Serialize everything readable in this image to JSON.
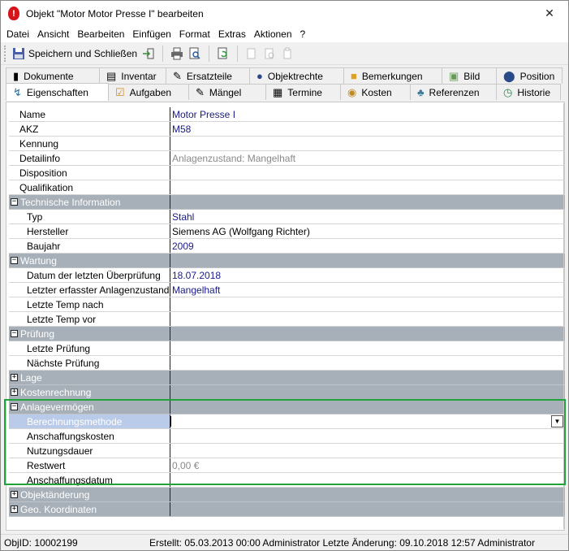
{
  "window": {
    "title": "Objekt \"Motor Motor Presse I\" bearbeiten",
    "app_icon": "!",
    "close_label": "✕"
  },
  "menu": [
    "Datei",
    "Ansicht",
    "Bearbeiten",
    "Einfügen",
    "Format",
    "Extras",
    "Aktionen",
    "?"
  ],
  "toolbar": {
    "save_close_label": "Speichern und Schließen"
  },
  "tabs": {
    "row1": [
      {
        "label": "Dokumente",
        "icon": "document-icon"
      },
      {
        "label": "Inventar",
        "icon": "inventory-icon"
      },
      {
        "label": "Ersatzteile",
        "icon": "spare-parts-icon"
      },
      {
        "label": "Objektrechte",
        "icon": "users-icon"
      },
      {
        "label": "Bemerkungen",
        "icon": "notes-icon"
      },
      {
        "label": "Bild",
        "icon": "image-icon"
      },
      {
        "label": "Position",
        "icon": "location-icon"
      }
    ],
    "row2": [
      {
        "label": "Eigenschaften",
        "icon": "properties-icon"
      },
      {
        "label": "Aufgaben",
        "icon": "tasks-icon"
      },
      {
        "label": "Mängel",
        "icon": "defects-icon"
      },
      {
        "label": "Termine",
        "icon": "calendar-icon"
      },
      {
        "label": "Kosten",
        "icon": "costs-icon"
      },
      {
        "label": "Referenzen",
        "icon": "references-icon"
      },
      {
        "label": "Historie",
        "icon": "history-icon"
      }
    ]
  },
  "properties": [
    {
      "type": "row",
      "label": "Name",
      "value": "Motor Presse I"
    },
    {
      "type": "row",
      "label": "AKZ",
      "value": "M58"
    },
    {
      "type": "row",
      "label": "Kennung",
      "value": ""
    },
    {
      "type": "row",
      "label": "Detailinfo",
      "value": "Anlagenzustand: Mangelhaft",
      "gray": true
    },
    {
      "type": "row",
      "label": "Disposition",
      "value": ""
    },
    {
      "type": "row",
      "label": "Qualifikation",
      "value": ""
    },
    {
      "type": "hdr",
      "label": "Technische Information",
      "expanded": true
    },
    {
      "type": "sub",
      "label": "Typ",
      "value": "Stahl"
    },
    {
      "type": "sub",
      "label": "Hersteller",
      "value": "Siemens AG    (Wolfgang Richter)",
      "dark": true
    },
    {
      "type": "sub",
      "label": "Baujahr",
      "value": "2009"
    },
    {
      "type": "hdr",
      "label": "Wartung",
      "expanded": true
    },
    {
      "type": "sub",
      "label": "Datum der letzten Überprüfung",
      "value": "18.07.2018"
    },
    {
      "type": "sub",
      "label": "Letzter erfasster Anlagenzustand",
      "value": "Mangelhaft"
    },
    {
      "type": "sub",
      "label": "Letzte Temp nach",
      "value": ""
    },
    {
      "type": "sub",
      "label": "Letzte Temp vor",
      "value": ""
    },
    {
      "type": "hdr",
      "label": "Prüfung",
      "expanded": true
    },
    {
      "type": "sub",
      "label": "Letzte Prüfung",
      "value": ""
    },
    {
      "type": "sub",
      "label": "Nächste Prüfung",
      "value": ""
    },
    {
      "type": "hdr",
      "label": "Lage",
      "expanded": false
    },
    {
      "type": "hdr",
      "label": "Kostenrechnung",
      "expanded": false
    },
    {
      "type": "hdr",
      "label": "Anlagevermögen",
      "expanded": true
    },
    {
      "type": "sub",
      "label": "Berechnungsmethode",
      "value": "",
      "selected": true,
      "dropdown": true
    },
    {
      "type": "sub",
      "label": "Anschaffungskosten",
      "value": ""
    },
    {
      "type": "sub",
      "label": "Nutzungsdauer",
      "value": ""
    },
    {
      "type": "sub",
      "label": "Restwert",
      "value": "0,00 €",
      "gray": true
    },
    {
      "type": "sub",
      "label": "Anschaffungsdatum",
      "value": ""
    },
    {
      "type": "hdr",
      "label": "Objektänderung",
      "expanded": false
    },
    {
      "type": "hdr",
      "label": "Geo. Koordinaten",
      "expanded": false
    }
  ],
  "status": {
    "objid": "ObjID: 10002199",
    "info": "Erstellt: 05.03.2013 00:00 Administrator  Letzte Änderung: 09.10.2018 12:57 Administrator"
  }
}
